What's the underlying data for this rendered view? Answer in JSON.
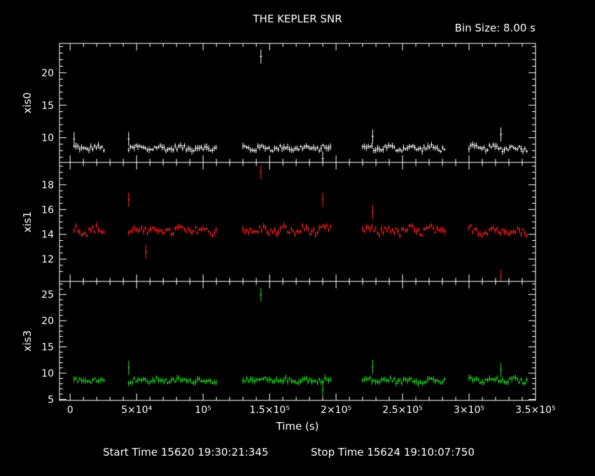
{
  "title": "THE KEPLER SNR",
  "bin_size": "Bin Size: 8.00 s",
  "xlabel": "Time (s)",
  "start_time": "Start Time 15620 19:30:21:345",
  "stop_time": "Stop Time 15624 19:10:07:750",
  "chart_data": {
    "type": "scatter",
    "x_range": [
      -8000,
      350000
    ],
    "x_ticks": [
      {
        "value": 0,
        "label": "0"
      },
      {
        "value": 50000,
        "label": "5×10⁴"
      },
      {
        "value": 100000,
        "label": "10⁵"
      },
      {
        "value": 150000,
        "label": "1.5×10⁵"
      },
      {
        "value": 200000,
        "label": "2×10⁵"
      },
      {
        "value": 250000,
        "label": "2.5×10⁵"
      },
      {
        "value": 300000,
        "label": "3×10⁵"
      },
      {
        "value": 350000,
        "label": "3.5×10⁵"
      }
    ],
    "segments": [
      [
        3000,
        26000
      ],
      [
        44000,
        111000
      ],
      [
        130000,
        196000
      ],
      [
        220000,
        282000
      ],
      [
        300000,
        344000
      ]
    ],
    "panels": [
      {
        "name": "xis0",
        "color": "#ffffff",
        "ylim": [
          6.2,
          24.5
        ],
        "yticks": [
          10,
          15,
          20
        ],
        "baseline": 8.4,
        "noise": 0.35,
        "outliers": [
          [
            3000,
            9.8
          ],
          [
            44000,
            9.8
          ],
          [
            143500,
            22.5
          ],
          [
            190000,
            6.8
          ],
          [
            227500,
            10.2
          ],
          [
            324000,
            10.5
          ]
        ]
      },
      {
        "name": "xis1",
        "color": "#ff2020",
        "ylim": [
          10.2,
          19.8
        ],
        "yticks": [
          12,
          14,
          16,
          18
        ],
        "baseline": 14.3,
        "noise": 0.3,
        "outliers": [
          [
            44000,
            16.8
          ],
          [
            57000,
            12.6
          ],
          [
            143500,
            19.0
          ],
          [
            190000,
            16.8
          ],
          [
            227500,
            15.8
          ],
          [
            324000,
            10.6
          ]
        ]
      },
      {
        "name": "xis3",
        "color": "#22dd22",
        "ylim": [
          4.8,
          27.5
        ],
        "yticks": [
          5,
          10,
          15,
          20,
          25
        ],
        "baseline": 8.6,
        "noise": 0.4,
        "outliers": [
          [
            44000,
            11.0
          ],
          [
            143500,
            25.0
          ],
          [
            190000,
            6.8
          ],
          [
            227500,
            11.2
          ],
          [
            324000,
            10.6
          ]
        ]
      }
    ]
  }
}
